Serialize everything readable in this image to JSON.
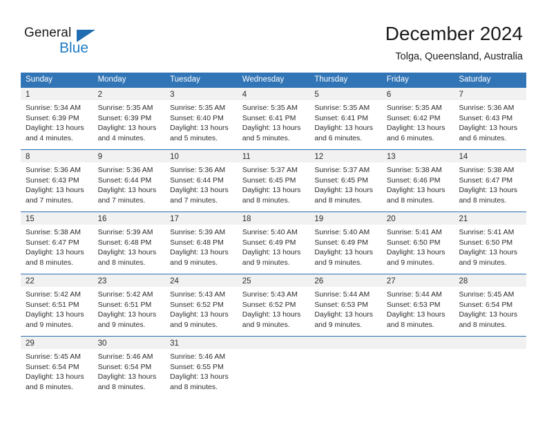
{
  "brand": {
    "name_part1": "General",
    "name_part2": "Blue",
    "triangle_color": "#1f6cb0",
    "blue_text_color": "#1f7cc4"
  },
  "header": {
    "title": "December 2024",
    "subtitle": "Tolga, Queensland, Australia"
  },
  "theme": {
    "header_blue": "#3275b6",
    "row_rule_blue": "#2a6db0",
    "daynum_strip": "#f1f1f1"
  },
  "weekdays": [
    "Sunday",
    "Monday",
    "Tuesday",
    "Wednesday",
    "Thursday",
    "Friday",
    "Saturday"
  ],
  "weeks": [
    [
      {
        "day": "1",
        "sunrise": "Sunrise: 5:34 AM",
        "sunset": "Sunset: 6:39 PM",
        "daylight1": "Daylight: 13 hours",
        "daylight2": "and 4 minutes."
      },
      {
        "day": "2",
        "sunrise": "Sunrise: 5:35 AM",
        "sunset": "Sunset: 6:39 PM",
        "daylight1": "Daylight: 13 hours",
        "daylight2": "and 4 minutes."
      },
      {
        "day": "3",
        "sunrise": "Sunrise: 5:35 AM",
        "sunset": "Sunset: 6:40 PM",
        "daylight1": "Daylight: 13 hours",
        "daylight2": "and 5 minutes."
      },
      {
        "day": "4",
        "sunrise": "Sunrise: 5:35 AM",
        "sunset": "Sunset: 6:41 PM",
        "daylight1": "Daylight: 13 hours",
        "daylight2": "and 5 minutes."
      },
      {
        "day": "5",
        "sunrise": "Sunrise: 5:35 AM",
        "sunset": "Sunset: 6:41 PM",
        "daylight1": "Daylight: 13 hours",
        "daylight2": "and 6 minutes."
      },
      {
        "day": "6",
        "sunrise": "Sunrise: 5:35 AM",
        "sunset": "Sunset: 6:42 PM",
        "daylight1": "Daylight: 13 hours",
        "daylight2": "and 6 minutes."
      },
      {
        "day": "7",
        "sunrise": "Sunrise: 5:36 AM",
        "sunset": "Sunset: 6:43 PM",
        "daylight1": "Daylight: 13 hours",
        "daylight2": "and 6 minutes."
      }
    ],
    [
      {
        "day": "8",
        "sunrise": "Sunrise: 5:36 AM",
        "sunset": "Sunset: 6:43 PM",
        "daylight1": "Daylight: 13 hours",
        "daylight2": "and 7 minutes."
      },
      {
        "day": "9",
        "sunrise": "Sunrise: 5:36 AM",
        "sunset": "Sunset: 6:44 PM",
        "daylight1": "Daylight: 13 hours",
        "daylight2": "and 7 minutes."
      },
      {
        "day": "10",
        "sunrise": "Sunrise: 5:36 AM",
        "sunset": "Sunset: 6:44 PM",
        "daylight1": "Daylight: 13 hours",
        "daylight2": "and 7 minutes."
      },
      {
        "day": "11",
        "sunrise": "Sunrise: 5:37 AM",
        "sunset": "Sunset: 6:45 PM",
        "daylight1": "Daylight: 13 hours",
        "daylight2": "and 8 minutes."
      },
      {
        "day": "12",
        "sunrise": "Sunrise: 5:37 AM",
        "sunset": "Sunset: 6:45 PM",
        "daylight1": "Daylight: 13 hours",
        "daylight2": "and 8 minutes."
      },
      {
        "day": "13",
        "sunrise": "Sunrise: 5:38 AM",
        "sunset": "Sunset: 6:46 PM",
        "daylight1": "Daylight: 13 hours",
        "daylight2": "and 8 minutes."
      },
      {
        "day": "14",
        "sunrise": "Sunrise: 5:38 AM",
        "sunset": "Sunset: 6:47 PM",
        "daylight1": "Daylight: 13 hours",
        "daylight2": "and 8 minutes."
      }
    ],
    [
      {
        "day": "15",
        "sunrise": "Sunrise: 5:38 AM",
        "sunset": "Sunset: 6:47 PM",
        "daylight1": "Daylight: 13 hours",
        "daylight2": "and 8 minutes."
      },
      {
        "day": "16",
        "sunrise": "Sunrise: 5:39 AM",
        "sunset": "Sunset: 6:48 PM",
        "daylight1": "Daylight: 13 hours",
        "daylight2": "and 8 minutes."
      },
      {
        "day": "17",
        "sunrise": "Sunrise: 5:39 AM",
        "sunset": "Sunset: 6:48 PM",
        "daylight1": "Daylight: 13 hours",
        "daylight2": "and 9 minutes."
      },
      {
        "day": "18",
        "sunrise": "Sunrise: 5:40 AM",
        "sunset": "Sunset: 6:49 PM",
        "daylight1": "Daylight: 13 hours",
        "daylight2": "and 9 minutes."
      },
      {
        "day": "19",
        "sunrise": "Sunrise: 5:40 AM",
        "sunset": "Sunset: 6:49 PM",
        "daylight1": "Daylight: 13 hours",
        "daylight2": "and 9 minutes."
      },
      {
        "day": "20",
        "sunrise": "Sunrise: 5:41 AM",
        "sunset": "Sunset: 6:50 PM",
        "daylight1": "Daylight: 13 hours",
        "daylight2": "and 9 minutes."
      },
      {
        "day": "21",
        "sunrise": "Sunrise: 5:41 AM",
        "sunset": "Sunset: 6:50 PM",
        "daylight1": "Daylight: 13 hours",
        "daylight2": "and 9 minutes."
      }
    ],
    [
      {
        "day": "22",
        "sunrise": "Sunrise: 5:42 AM",
        "sunset": "Sunset: 6:51 PM",
        "daylight1": "Daylight: 13 hours",
        "daylight2": "and 9 minutes."
      },
      {
        "day": "23",
        "sunrise": "Sunrise: 5:42 AM",
        "sunset": "Sunset: 6:51 PM",
        "daylight1": "Daylight: 13 hours",
        "daylight2": "and 9 minutes."
      },
      {
        "day": "24",
        "sunrise": "Sunrise: 5:43 AM",
        "sunset": "Sunset: 6:52 PM",
        "daylight1": "Daylight: 13 hours",
        "daylight2": "and 9 minutes."
      },
      {
        "day": "25",
        "sunrise": "Sunrise: 5:43 AM",
        "sunset": "Sunset: 6:52 PM",
        "daylight1": "Daylight: 13 hours",
        "daylight2": "and 9 minutes."
      },
      {
        "day": "26",
        "sunrise": "Sunrise: 5:44 AM",
        "sunset": "Sunset: 6:53 PM",
        "daylight1": "Daylight: 13 hours",
        "daylight2": "and 9 minutes."
      },
      {
        "day": "27",
        "sunrise": "Sunrise: 5:44 AM",
        "sunset": "Sunset: 6:53 PM",
        "daylight1": "Daylight: 13 hours",
        "daylight2": "and 8 minutes."
      },
      {
        "day": "28",
        "sunrise": "Sunrise: 5:45 AM",
        "sunset": "Sunset: 6:54 PM",
        "daylight1": "Daylight: 13 hours",
        "daylight2": "and 8 minutes."
      }
    ],
    [
      {
        "day": "29",
        "sunrise": "Sunrise: 5:45 AM",
        "sunset": "Sunset: 6:54 PM",
        "daylight1": "Daylight: 13 hours",
        "daylight2": "and 8 minutes."
      },
      {
        "day": "30",
        "sunrise": "Sunrise: 5:46 AM",
        "sunset": "Sunset: 6:54 PM",
        "daylight1": "Daylight: 13 hours",
        "daylight2": "and 8 minutes."
      },
      {
        "day": "31",
        "sunrise": "Sunrise: 5:46 AM",
        "sunset": "Sunset: 6:55 PM",
        "daylight1": "Daylight: 13 hours",
        "daylight2": "and 8 minutes."
      },
      {
        "day": "",
        "sunrise": "",
        "sunset": "",
        "daylight1": "",
        "daylight2": ""
      },
      {
        "day": "",
        "sunrise": "",
        "sunset": "",
        "daylight1": "",
        "daylight2": ""
      },
      {
        "day": "",
        "sunrise": "",
        "sunset": "",
        "daylight1": "",
        "daylight2": ""
      },
      {
        "day": "",
        "sunrise": "",
        "sunset": "",
        "daylight1": "",
        "daylight2": ""
      }
    ]
  ]
}
